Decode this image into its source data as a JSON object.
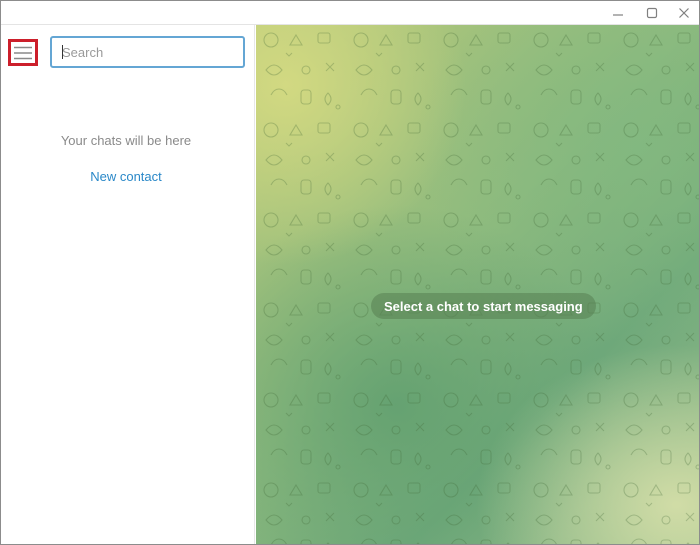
{
  "window": {
    "controls": {
      "minimize_icon": "minimize-icon",
      "maximize_icon": "maximize-icon",
      "close_icon": "close-icon"
    }
  },
  "sidebar": {
    "menu_icon": "hamburger-menu-icon",
    "search": {
      "placeholder": "Search",
      "value": ""
    },
    "empty_message": "Your chats will be here",
    "new_contact_label": "New contact"
  },
  "chat": {
    "empty_prompt": "Select a chat to start messaging"
  },
  "colors": {
    "accent": "#2a88c8",
    "search_border": "#64a6d4",
    "highlight_border": "#cc1f2b",
    "muted_text": "#8a8a8a"
  }
}
